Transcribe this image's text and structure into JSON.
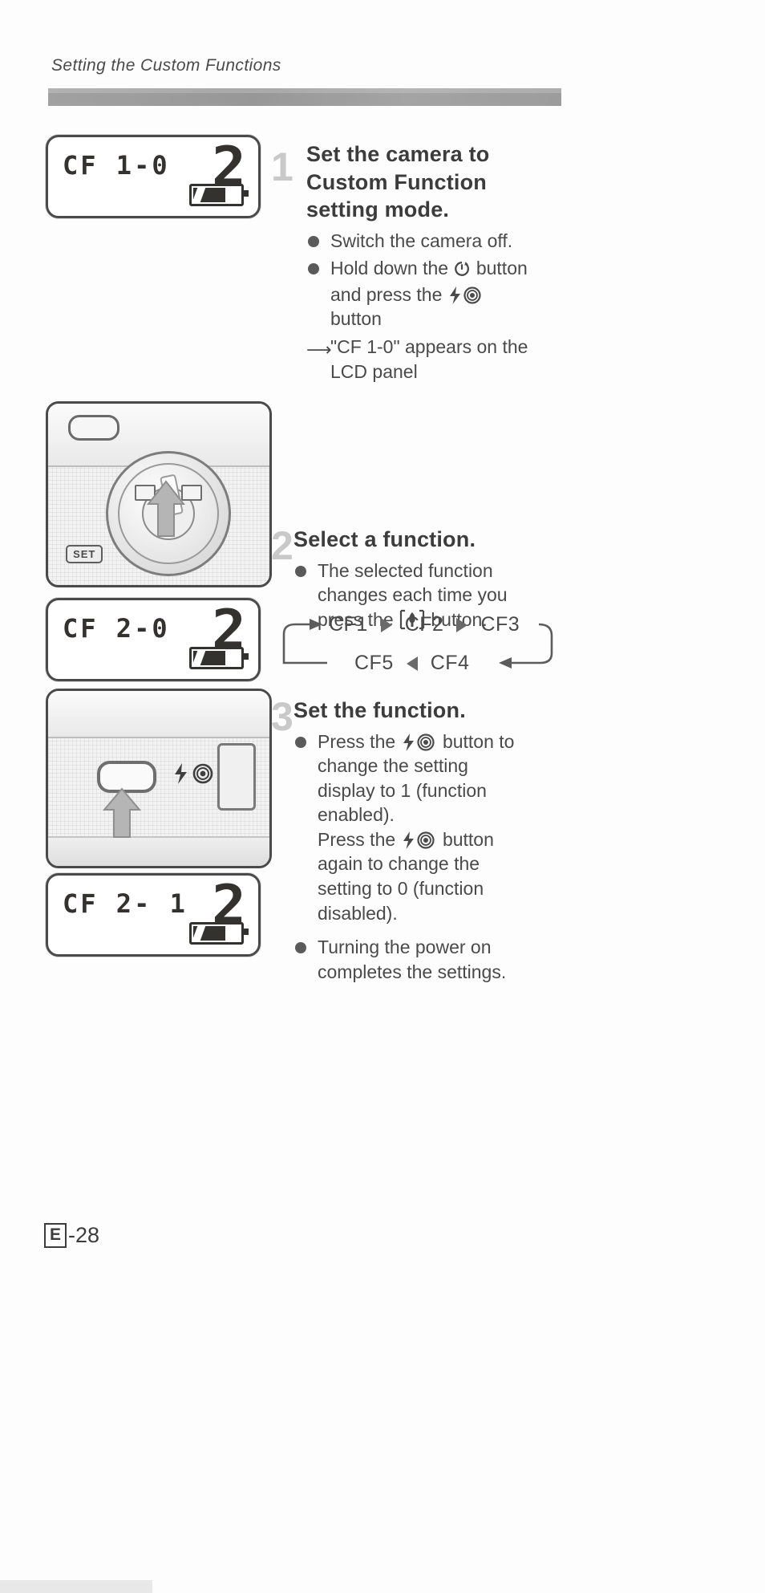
{
  "header": {
    "title": "Setting the Custom Functions"
  },
  "lcd_panels": {
    "panel1": {
      "text": "CF 1-0",
      "digit": "2",
      "battery": "battery-icon"
    },
    "panel2": {
      "text": "CF 2-0",
      "digit": "2",
      "battery": "battery-icon"
    },
    "panel3": {
      "text": "CF 2- 1",
      "digit": "2",
      "battery": "battery-icon"
    }
  },
  "photos": {
    "dial": {
      "set_label": "SET",
      "caption": "camera-mode-dial"
    },
    "flash": {
      "label": "flash-redeye-button"
    }
  },
  "steps": [
    {
      "number": "1",
      "title": "Set the camera to Custom Function setting mode.",
      "title_lines": [
        "Set the camera to",
        "Custom Function",
        "setting mode."
      ],
      "bullets": [
        {
          "pre": "Switch the camera off",
          "post": ""
        },
        {
          "pre": "Hold down the",
          "mid_icon": "self-timer-icon",
          "post": "button",
          "cont1_pre": "and press the",
          "cont1_icon": "flash-redeye-icon",
          "cont2": "button"
        }
      ],
      "result": {
        "pre": "\"CF 1-0\" appears on the",
        "line2": "LCD panel"
      }
    },
    {
      "number": "2",
      "title": "Select a function.",
      "bullets": [
        {
          "line1": "The selected function",
          "line2": "changes each time you",
          "line3_pre": "press the",
          "line3_icon": "landscape-button-icon",
          "line3_post": "button"
        }
      ]
    },
    {
      "number": "3",
      "title": "Set the function.",
      "bullets": [
        {
          "line1_pre": "Press the",
          "line1_icon": "flash-redeye-icon",
          "line1_post": "button to",
          "line2": "change the setting",
          "line3": "display to 1 (function",
          "line4": "enabled).",
          "line5_pre": "Press the",
          "line5_icon": "flash-redeye-icon",
          "line5_post": "button",
          "line6": "again to change the",
          "line7": "setting to 0 (function",
          "line8": "disabled)."
        },
        {
          "line1": "Turning the power on",
          "line2": "completes the settings"
        }
      ]
    }
  ],
  "cycle_diagram": {
    "top_row": [
      "CF1",
      "CF2",
      "CF3"
    ],
    "bottom_row": [
      "CF5",
      "CF4"
    ],
    "separator": "arrow-right-icon",
    "bottom_separator": "arrow-left-icon"
  },
  "footer": {
    "marker": "E",
    "page": "-28"
  },
  "colors": {
    "text": "#4a4a4a",
    "heading": "#3c3c3c",
    "stepnum": "#c9c9c9",
    "bar": "#969696"
  }
}
